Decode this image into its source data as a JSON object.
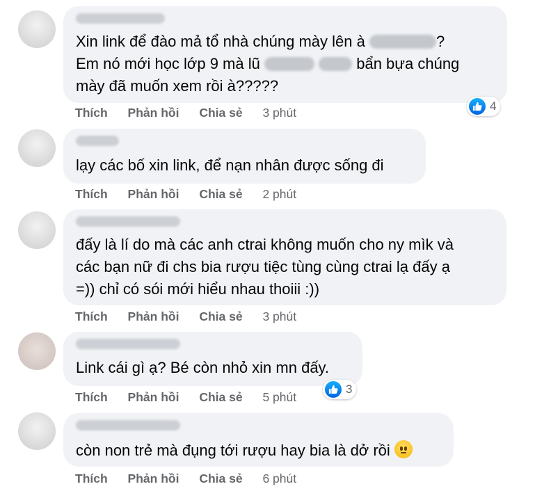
{
  "actions": {
    "like": "Thích",
    "reply": "Phản hồi",
    "share": "Chia sẻ"
  },
  "comments": [
    {
      "lines": [
        "Xin link để đào mả tổ nhà chúng mày lên à",
        "Em nó mới học lớp 9 mà lũ",
        "bẩn bựa chúng",
        "mày đã muốn xem rồi à?????"
      ],
      "line1_end": "?",
      "time": "3 phút",
      "reactions": "4"
    },
    {
      "lines": [
        "lạy các bố xin link, để nạn nhân được sống đi"
      ],
      "time": "2 phút"
    },
    {
      "lines": [
        "đấy là lí do mà các anh ctrai không muốn cho ny mìk và",
        "các bạn nữ đi chs bia rượu tiệc tùng cùng ctrai lạ đấy ạ",
        "=)) chỉ có sói mới hiểu nhau thoiii :))"
      ],
      "time": "3 phút"
    },
    {
      "lines": [
        "Link cái gì ạ? Bé còn nhỏ xin mn đấy."
      ],
      "time": "5 phút",
      "reactions": "3"
    },
    {
      "lines": [
        "còn non trẻ mà đụng tới rượu hay bia là dở rồi"
      ],
      "time": "6 phút",
      "emoji": "neutral-face-emoji"
    }
  ],
  "colors": {
    "bubble": "#f0f2f5",
    "meta": "#65676b",
    "like": "#0866ff"
  }
}
